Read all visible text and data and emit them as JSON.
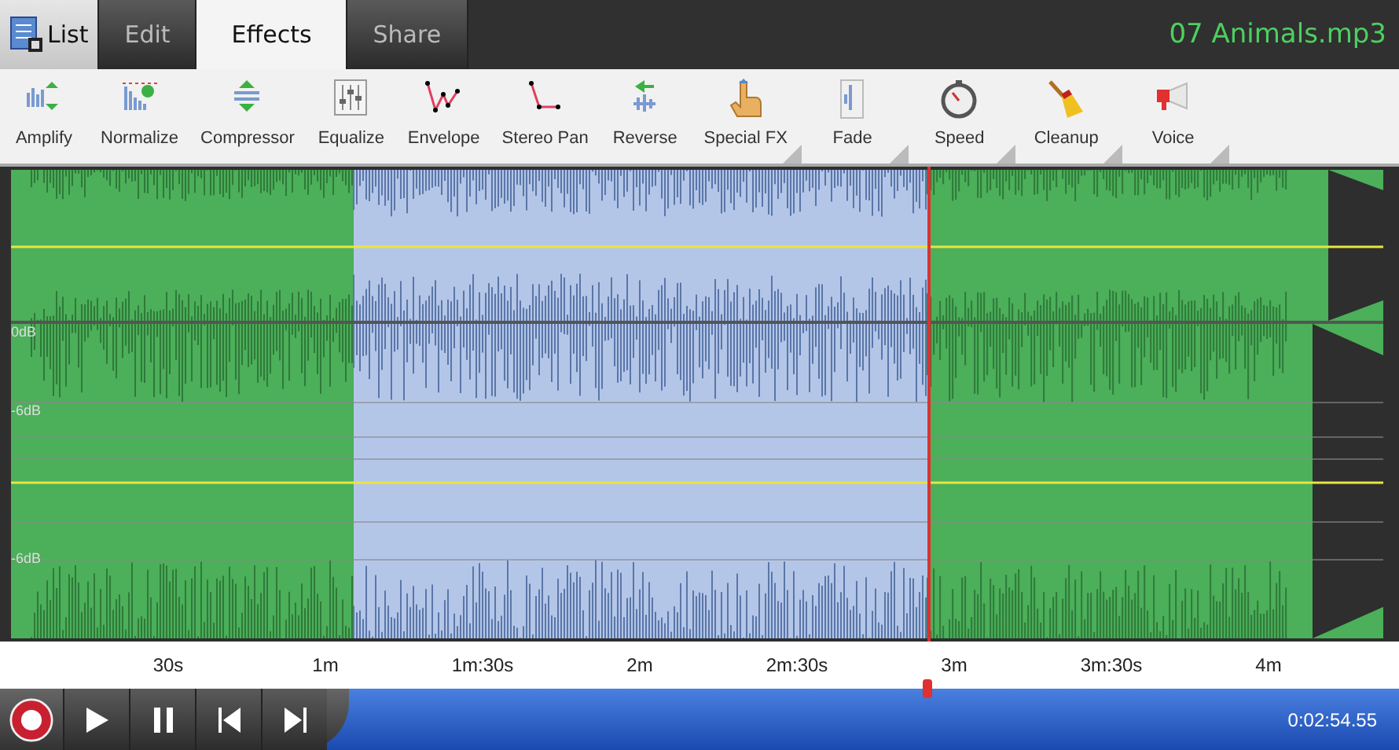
{
  "tabs": [
    {
      "label": "List",
      "kind": "icon",
      "selected": false
    },
    {
      "label": "Edit",
      "kind": "plain",
      "selected": false
    },
    {
      "label": "Effects",
      "kind": "plain",
      "selected": true
    },
    {
      "label": "Share",
      "kind": "plain",
      "selected": false
    }
  ],
  "file_name": "07 Animals.mp3",
  "effects": [
    {
      "label": "Amplify",
      "kind": "amplify",
      "has_menu": false
    },
    {
      "label": "Normalize",
      "kind": "normalize",
      "has_menu": false
    },
    {
      "label": "Compressor",
      "kind": "compressor",
      "has_menu": false
    },
    {
      "label": "Equalize",
      "kind": "equalize",
      "has_menu": false
    },
    {
      "label": "Envelope",
      "kind": "envelope",
      "has_menu": false
    },
    {
      "label": "Stereo Pan",
      "kind": "pan",
      "has_menu": false
    },
    {
      "label": "Reverse",
      "kind": "reverse",
      "has_menu": false
    },
    {
      "label": "Special FX",
      "kind": "fx",
      "has_menu": true
    },
    {
      "label": "Fade",
      "kind": "fade",
      "has_menu": true
    },
    {
      "label": "Speed",
      "kind": "speed",
      "has_menu": true
    },
    {
      "label": "Cleanup",
      "kind": "cleanup",
      "has_menu": true
    },
    {
      "label": "Voice",
      "kind": "voice",
      "has_menu": true
    }
  ],
  "db_labels": [
    "0dB",
    "-6dB",
    "-6dB"
  ],
  "playhead": {
    "level": 0.663
  },
  "ruler": [
    "30s",
    "1m",
    "1m:30s",
    "2m",
    "2m:30s",
    "3m",
    "3m:30s",
    "4m"
  ],
  "time": "0:02:54.55"
}
